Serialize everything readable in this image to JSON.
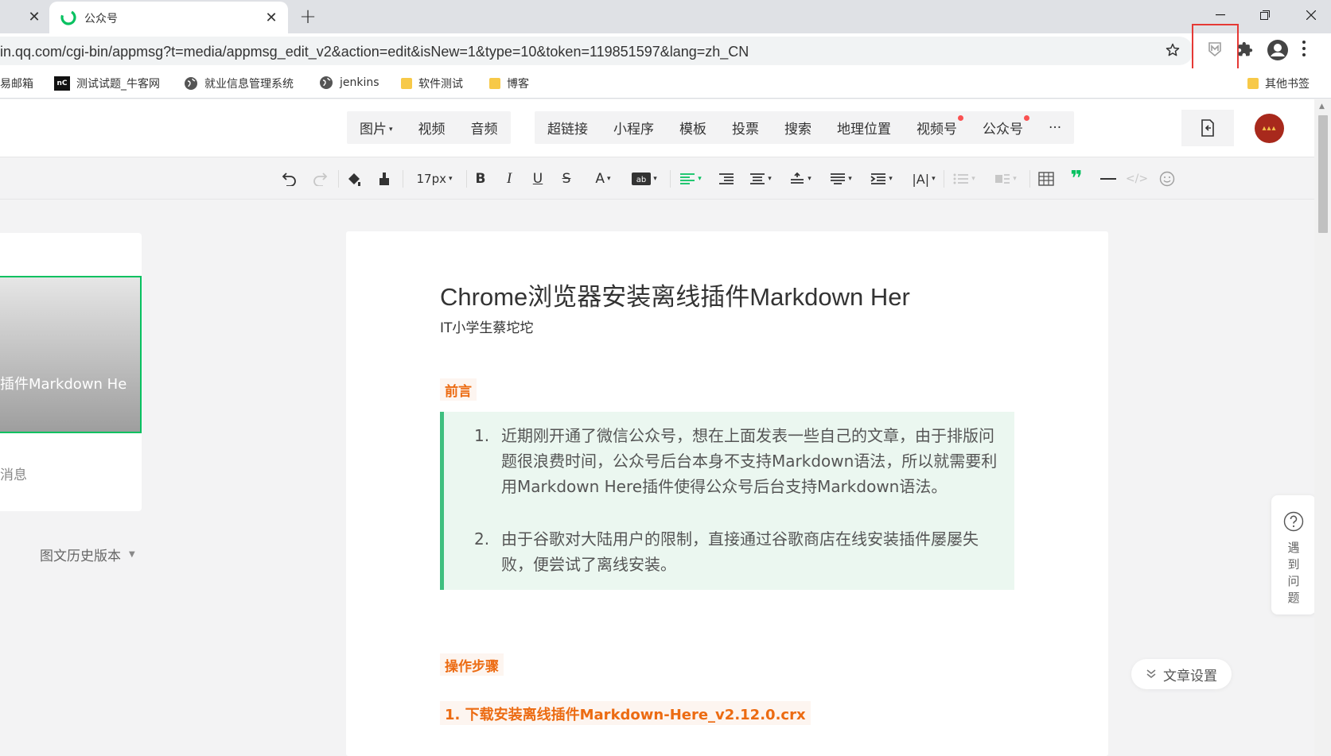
{
  "browser": {
    "tab_title": "公众号",
    "url": "in.qq.com/cgi-bin/appmsg?t=media/appmsg_edit_v2&action=edit&isNew=1&type=10&token=119851597&lang=zh_CN",
    "bookmarks": [
      {
        "label": "易邮箱",
        "icon": "globe-icon"
      },
      {
        "label": "测试试题_牛客网",
        "icon": "nowcoder-icon"
      },
      {
        "label": "就业信息管理系统",
        "icon": "globe-icon"
      },
      {
        "label": "jenkins",
        "icon": "globe-icon"
      },
      {
        "label": "软件测试",
        "icon": "folder-icon"
      },
      {
        "label": "博客",
        "icon": "folder-icon"
      },
      {
        "label": "其他书签",
        "icon": "folder-icon"
      }
    ],
    "highlight_color": "#e53935"
  },
  "insert_menu": {
    "media": [
      "图片",
      "视频",
      "音频"
    ],
    "more": [
      "超链接",
      "小程序",
      "模板",
      "投票",
      "搜索",
      "地理位置",
      "视频号",
      "公众号"
    ],
    "more_button": "···"
  },
  "format_toolbar": {
    "font_size": "17px"
  },
  "left_panel": {
    "cover_title": "插件Markdown He",
    "message_label": "消息",
    "history_label": "图文历史版本"
  },
  "article": {
    "title": "Chrome浏览器安装离线插件Markdown Her",
    "author": "IT小学生蔡坨坨",
    "heading_intro": "前言",
    "intro_items": [
      {
        "num": "1.",
        "text": "近期刚开通了微信公众号，想在上面发表一些自己的文章，由于排版问题很浪费时间，公众号后台本身不支持Markdown语法，所以就需要利用Markdown Here插件使得公众号后台支持Markdown语法。"
      },
      {
        "num": "2.",
        "text": "由于谷歌对大陆用户的限制，直接通过谷歌商店在线安装插件屡屡失败，便尝试了离线安装。"
      }
    ],
    "heading_steps": "操作步骤",
    "step_1": "1. 下载安装离线插件Markdown-Here_v2.12.0.crx",
    "accent_color": "#ec6b12",
    "quote_bg": "#ebf7f0"
  },
  "widgets": {
    "help_text": "遇到问题",
    "settings_label": "文章设置"
  }
}
